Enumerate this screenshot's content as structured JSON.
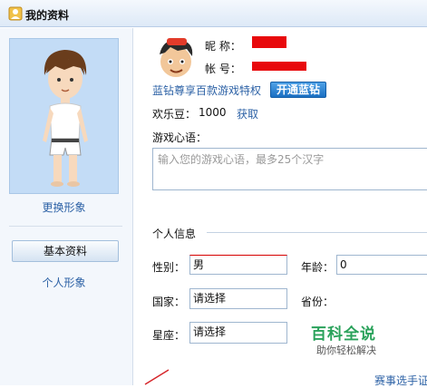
{
  "window": {
    "title": "我的资料",
    "icon": "user-profile-icon"
  },
  "sidebar": {
    "change_avatar": "更换形象",
    "basic_info": "基本资料",
    "personal_image": "个人形象"
  },
  "profile": {
    "nickname_label": "昵 称：",
    "account_label": "帐 号：",
    "vip_promo": "蓝钻尊享百款游戏特权",
    "vip_button": "开通蓝钻",
    "beans_label": "欢乐豆：",
    "beans_value": "1000",
    "get_link": "获取",
    "motto_label": "游戏心语：",
    "motto_placeholder": "输入您的游戏心语，最多25个汉字"
  },
  "personal_info": {
    "section_title": "个人信息",
    "gender_label": "性别：",
    "gender_value": "男",
    "age_label": "年龄：",
    "age_value": "0",
    "country_label": "国家：",
    "country_value": "请选择",
    "province_label": "省份：",
    "constellation_label": "星座：",
    "constellation_value": "请选择"
  },
  "watermark": {
    "title": "百科全说",
    "subtitle": "助你轻松解决"
  },
  "partial_link": "赛事选手证",
  "colors": {
    "accent": "#2d62a6",
    "redact": "#e8090c",
    "watermark": "#2aa25b"
  }
}
